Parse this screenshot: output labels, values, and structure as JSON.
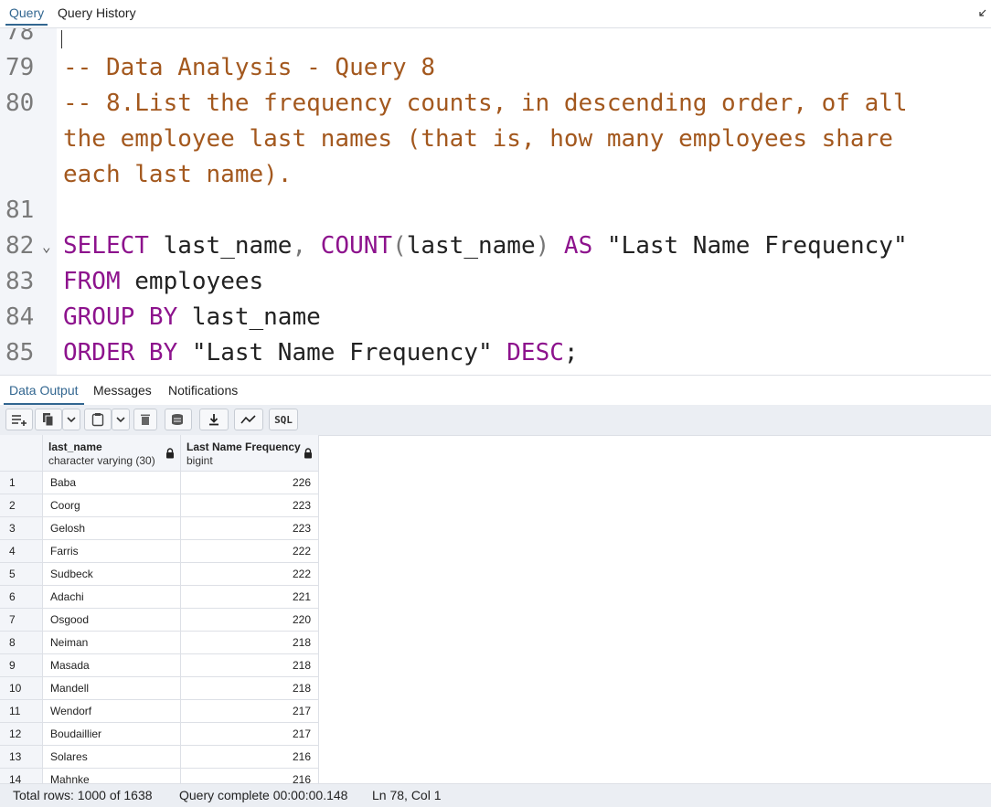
{
  "query_tabs": {
    "query": "Query",
    "history": "Query History"
  },
  "editor": {
    "lines": [
      {
        "num": "78",
        "fold": "",
        "segments": []
      },
      {
        "num": "79",
        "fold": "",
        "segments": [
          {
            "cls": "comment",
            "text": "-- Data Analysis - Query 8"
          }
        ]
      },
      {
        "num": "80",
        "fold": "",
        "segments": [
          {
            "cls": "comment",
            "text": "-- 8.List the frequency counts, in descending order, of all"
          }
        ]
      },
      {
        "num": "",
        "fold": "",
        "segments": [
          {
            "cls": "comment",
            "text": "the employee last names (that is, how many employees share"
          }
        ]
      },
      {
        "num": "",
        "fold": "",
        "segments": [
          {
            "cls": "comment",
            "text": "each last name)."
          }
        ]
      },
      {
        "num": "81",
        "fold": "",
        "segments": []
      },
      {
        "num": "82",
        "fold": "⌄",
        "segments": [
          {
            "cls": "kw",
            "text": "SELECT"
          },
          {
            "cls": "plain",
            "text": " last_name"
          },
          {
            "cls": "punc",
            "text": ","
          },
          {
            "cls": "plain",
            "text": " "
          },
          {
            "cls": "kw",
            "text": "COUNT"
          },
          {
            "cls": "punc",
            "text": "("
          },
          {
            "cls": "plain",
            "text": "last_name"
          },
          {
            "cls": "punc",
            "text": ")"
          },
          {
            "cls": "plain",
            "text": " "
          },
          {
            "cls": "kw",
            "text": "AS"
          },
          {
            "cls": "plain",
            "text": " "
          },
          {
            "cls": "str",
            "text": "\"Last Name Frequency\""
          }
        ]
      },
      {
        "num": "83",
        "fold": "",
        "segments": [
          {
            "cls": "kw",
            "text": "FROM"
          },
          {
            "cls": "plain",
            "text": " employees"
          }
        ]
      },
      {
        "num": "84",
        "fold": "",
        "segments": [
          {
            "cls": "kw",
            "text": "GROUP BY"
          },
          {
            "cls": "plain",
            "text": " last_name"
          }
        ]
      },
      {
        "num": "85",
        "fold": "",
        "segments": [
          {
            "cls": "kw",
            "text": "ORDER BY"
          },
          {
            "cls": "plain",
            "text": " "
          },
          {
            "cls": "str",
            "text": "\"Last Name Frequency\""
          },
          {
            "cls": "plain",
            "text": " "
          },
          {
            "cls": "kw",
            "text": "DESC"
          },
          {
            "cls": "plain",
            "text": ";"
          }
        ]
      }
    ]
  },
  "result_tabs": {
    "data_output": "Data Output",
    "messages": "Messages",
    "notifications": "Notifications"
  },
  "toolbar": {
    "buttons": [
      "add-row-icon",
      "copy-icon",
      "chevron-down-icon",
      "paste-icon",
      "chevron-down-icon",
      "delete-icon",
      "save-data-icon",
      "download-icon",
      "graph-icon",
      "sql-icon"
    ],
    "sql_label": "SQL"
  },
  "grid": {
    "columns": [
      {
        "name": "last_name",
        "type": "character varying (30)"
      },
      {
        "name": "Last Name Frequency",
        "type": "bigint"
      }
    ],
    "rows": [
      {
        "idx": "1",
        "last_name": "Baba",
        "freq": "226"
      },
      {
        "idx": "2",
        "last_name": "Coorg",
        "freq": "223"
      },
      {
        "idx": "3",
        "last_name": "Gelosh",
        "freq": "223"
      },
      {
        "idx": "4",
        "last_name": "Farris",
        "freq": "222"
      },
      {
        "idx": "5",
        "last_name": "Sudbeck",
        "freq": "222"
      },
      {
        "idx": "6",
        "last_name": "Adachi",
        "freq": "221"
      },
      {
        "idx": "7",
        "last_name": "Osgood",
        "freq": "220"
      },
      {
        "idx": "8",
        "last_name": "Neiman",
        "freq": "218"
      },
      {
        "idx": "9",
        "last_name": "Masada",
        "freq": "218"
      },
      {
        "idx": "10",
        "last_name": "Mandell",
        "freq": "218"
      },
      {
        "idx": "11",
        "last_name": "Wendorf",
        "freq": "217"
      },
      {
        "idx": "12",
        "last_name": "Boudaillier",
        "freq": "217"
      },
      {
        "idx": "13",
        "last_name": "Solares",
        "freq": "216"
      },
      {
        "idx": "14",
        "last_name": "Mahnke",
        "freq": "216"
      }
    ]
  },
  "status": {
    "total_rows": "Total rows: 1000 of 1638",
    "query_status": "Query complete 00:00:00.148",
    "cursor_pos": "Ln 78, Col 1"
  },
  "colors": {
    "accent": "#326690",
    "keyword": "#8d138d",
    "comment": "#a3581e"
  }
}
